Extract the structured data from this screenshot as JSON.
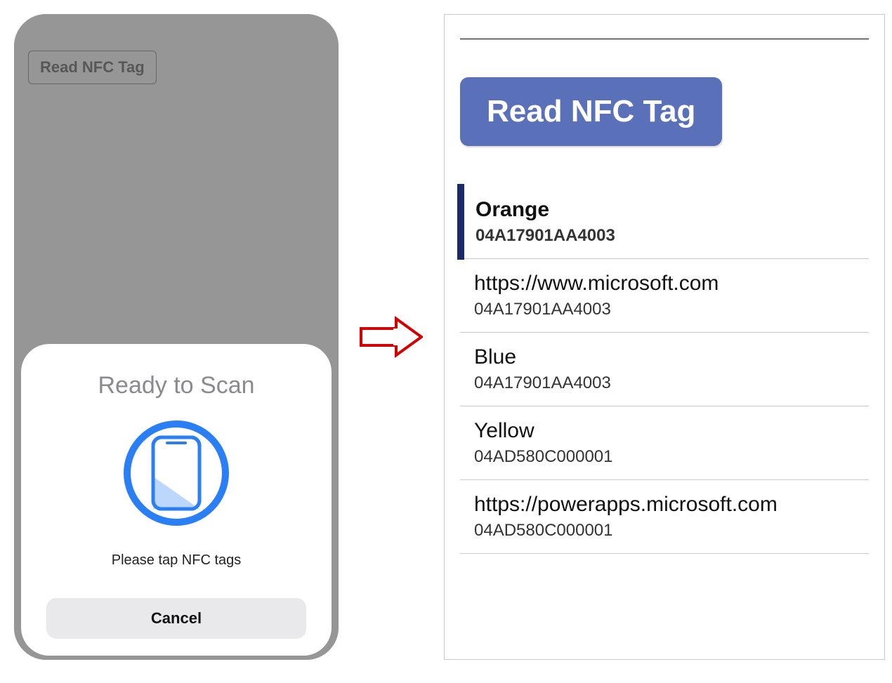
{
  "phone": {
    "read_button_label": "Read NFC Tag",
    "scan_sheet": {
      "title": "Ready to Scan",
      "subtext": "Please tap NFC tags",
      "cancel_label": "Cancel"
    }
  },
  "result_panel": {
    "read_button_label": "Read NFC Tag",
    "items": [
      {
        "title": "Orange",
        "subtitle": "04A17901AA4003",
        "selected": true
      },
      {
        "title": "https://www.microsoft.com",
        "subtitle": "04A17901AA4003",
        "selected": false
      },
      {
        "title": "Blue",
        "subtitle": "04A17901AA4003",
        "selected": false
      },
      {
        "title": "Yellow",
        "subtitle": "04AD580C000001",
        "selected": false
      },
      {
        "title": "https://powerapps.microsoft.com",
        "subtitle": "04AD580C000001",
        "selected": false
      }
    ]
  }
}
